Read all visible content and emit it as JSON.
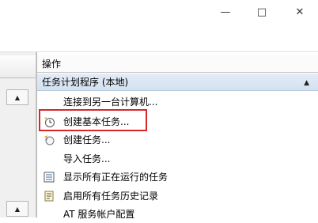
{
  "window": {
    "minimize_glyph": "—",
    "maximize_glyph": "□",
    "close_glyph": "✕"
  },
  "left_pane": {
    "scroll_up_glyph": "▲"
  },
  "actions_panel": {
    "header": "操作",
    "section_title": "任务计划程序 (本地)",
    "collapse_glyph": "▲",
    "items": [
      {
        "label": "连接到另一台计算机...",
        "icon": "none"
      },
      {
        "label": "创建基本任务...",
        "icon": "clock-wizard-icon"
      },
      {
        "label": "创建任务...",
        "icon": "task-create-icon"
      },
      {
        "label": "导入任务...",
        "icon": "none"
      },
      {
        "label": "显示所有正在运行的任务",
        "icon": "running-tasks-icon"
      },
      {
        "label": "启用所有任务历史记录",
        "icon": "history-icon"
      },
      {
        "label": "AT 服务帐户配置",
        "icon": "none"
      }
    ]
  },
  "colors": {
    "highlight_border": "#d9262a",
    "section_header_bg": "#d3e1f0"
  }
}
